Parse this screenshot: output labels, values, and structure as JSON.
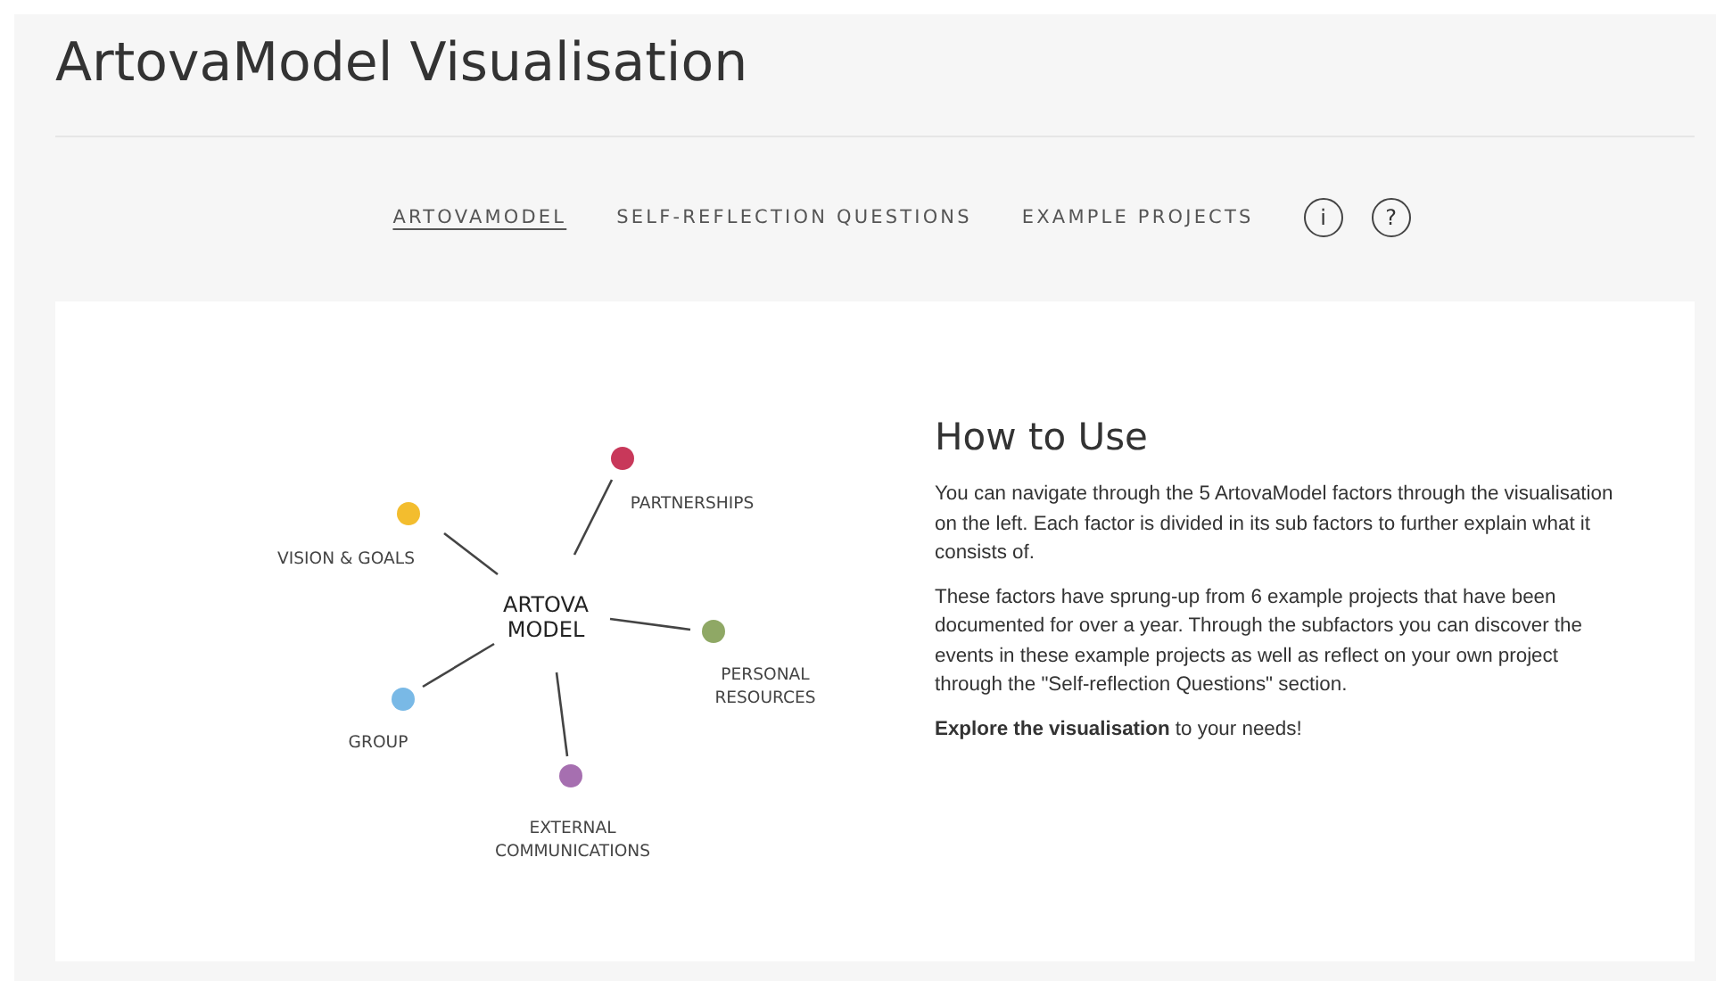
{
  "title": "ArtovaModel Visualisation",
  "nav": [
    {
      "label": "ARTOVAMODEL",
      "selected": true
    },
    {
      "label": "SELF-REFLECTION QUESTIONS",
      "selected": false
    },
    {
      "label": "EXAMPLE PROJECTS",
      "selected": false
    }
  ],
  "nav_icons": [
    {
      "label": "i"
    },
    {
      "label": "?"
    }
  ],
  "model": {
    "center": [
      "ARTOVA",
      "MODEL"
    ],
    "factors": [
      {
        "label": [
          "PARTNERSHIPS"
        ],
        "color": "#c8385a"
      },
      {
        "label": [
          "VISION & GOALS"
        ],
        "color": "#f3bd2e"
      },
      {
        "label": [
          "PERSONAL",
          "RESOURCES"
        ],
        "color": "#8fa865"
      },
      {
        "label": [
          "GROUP"
        ],
        "color": "#79b9e6"
      },
      {
        "label": [
          "EXTERNAL",
          "COMMUNICATIONS"
        ],
        "color": "#a66fb0"
      }
    ]
  },
  "how_to": {
    "heading": "How to Use",
    "paragraphs": [
      "You can navigate through the 5 ArtovaModel factors through the visualisation on the left. Each factor is divided in its sub factors to further explain what it consists of.",
      "These factors have sprung-up from 6 example projects that have been documented for over a year. Through the subfactors you can discover the events in these example projects as well as reflect on your own project through the \"Self-reflection Questions\" section.",
      "**Explore the visualisation** to your needs!"
    ]
  }
}
